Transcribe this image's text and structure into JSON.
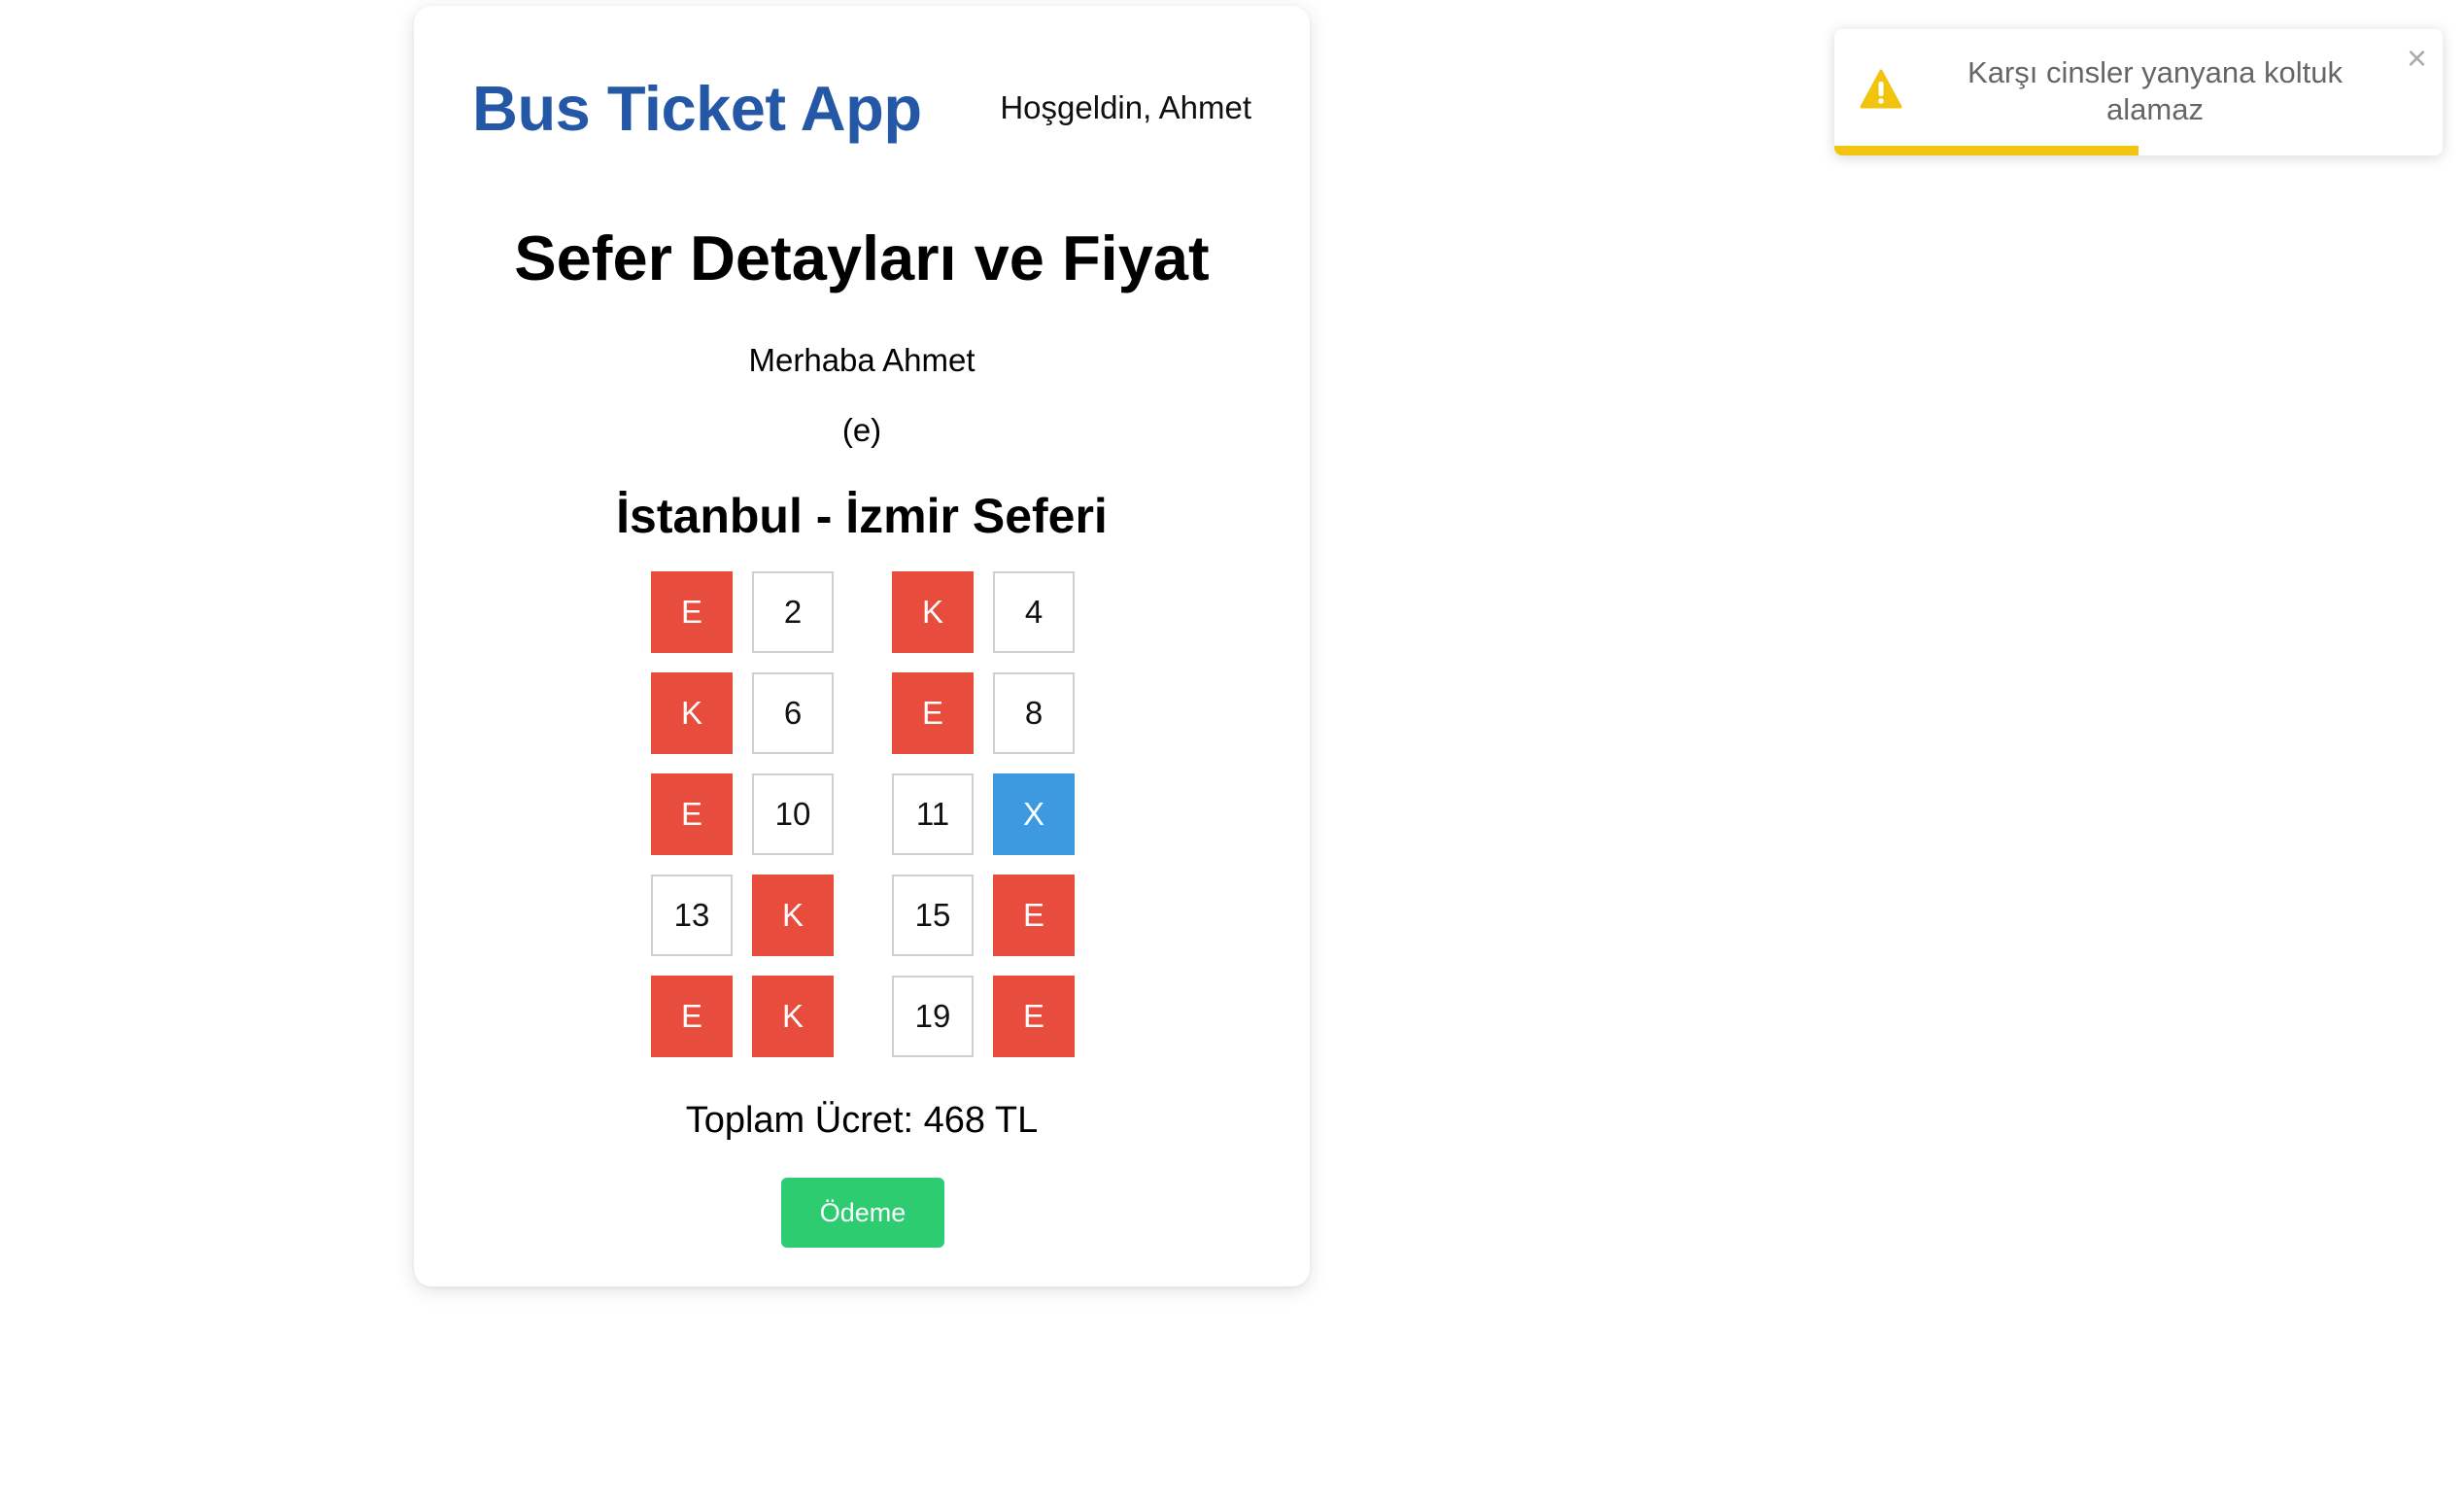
{
  "header": {
    "app_title": "Bus Ticket App",
    "welcome": "Hoşgeldin, Ahmet"
  },
  "main": {
    "title": "Sefer Detayları ve Fiyat",
    "greeting_line1": "Merhaba Ahmet",
    "greeting_line2": "(e)",
    "route": "İstanbul - İzmir Seferi",
    "seats": [
      {
        "label": "E",
        "state": "taken"
      },
      {
        "label": "2",
        "state": "empty"
      },
      {
        "label": "K",
        "state": "taken"
      },
      {
        "label": "4",
        "state": "empty"
      },
      {
        "label": "K",
        "state": "taken"
      },
      {
        "label": "6",
        "state": "empty"
      },
      {
        "label": "E",
        "state": "taken"
      },
      {
        "label": "8",
        "state": "empty"
      },
      {
        "label": "E",
        "state": "taken"
      },
      {
        "label": "10",
        "state": "empty"
      },
      {
        "label": "11",
        "state": "empty"
      },
      {
        "label": "X",
        "state": "selected"
      },
      {
        "label": "13",
        "state": "empty"
      },
      {
        "label": "K",
        "state": "taken"
      },
      {
        "label": "15",
        "state": "empty"
      },
      {
        "label": "E",
        "state": "taken"
      },
      {
        "label": "E",
        "state": "taken"
      },
      {
        "label": "K",
        "state": "taken"
      },
      {
        "label": "19",
        "state": "empty"
      },
      {
        "label": "E",
        "state": "taken"
      }
    ],
    "total": "Toplam Ücret: 468 TL",
    "pay_label": "Ödeme"
  },
  "toast": {
    "message": "Karşı cinsler yanyana koltuk alamaz",
    "close": "×",
    "icon": "warning-icon",
    "progress": 0.5
  },
  "colors": {
    "brand": "#2557a7",
    "taken": "#e74c3c",
    "selected": "#3d9ae0",
    "pay": "#2ecc71",
    "toast_progress": "#f1c40f"
  }
}
